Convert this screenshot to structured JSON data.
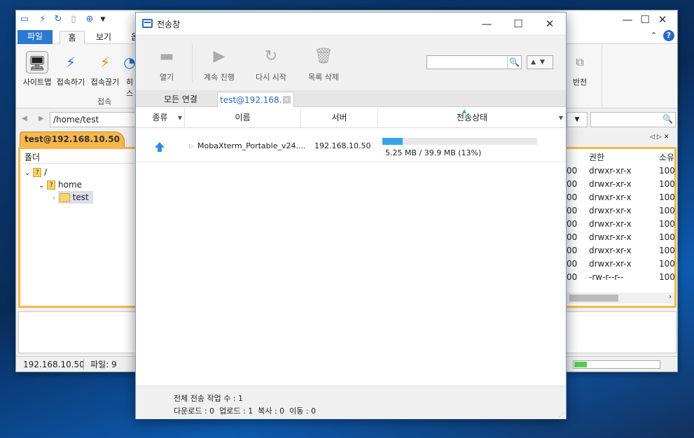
{
  "main_window": {
    "ribbon_tabs": [
      "파일",
      "홈",
      "보기",
      "옵"
    ],
    "ribbon_buttons": [
      "사이트맵",
      "접속하기",
      "접속끊기",
      "히스"
    ],
    "group_label": "접속",
    "right_group_label": "반전",
    "path": "/home/test",
    "pane_tab": "test@192.168.10.50",
    "folder_header": "폴더",
    "tree": [
      {
        "label": "/"
      },
      {
        "label": "home"
      },
      {
        "label": "test"
      }
    ],
    "list_headers": {
      "perm": "권한",
      "owner": "소유"
    },
    "list_rows": [
      {
        "size_tail": "00",
        "perm": "drwxr-xr-x",
        "owner": "100"
      },
      {
        "size_tail": "00",
        "perm": "drwxr-xr-x",
        "owner": "100"
      },
      {
        "size_tail": "00",
        "perm": "drwxr-xr-x",
        "owner": "100"
      },
      {
        "size_tail": "00",
        "perm": "drwxr-xr-x",
        "owner": "100"
      },
      {
        "size_tail": "00",
        "perm": "drwxr-xr-x",
        "owner": "100"
      },
      {
        "size_tail": "00",
        "perm": "drwxr-xr-x",
        "owner": "100"
      },
      {
        "size_tail": "00",
        "perm": "drwxr-xr-x",
        "owner": "100"
      },
      {
        "size_tail": "00",
        "perm": "drwxr-xr-x",
        "owner": "100"
      },
      {
        "size_tail": "00",
        "perm": "-rw-r--r--",
        "owner": "100"
      }
    ],
    "status": {
      "host": "192.168.10.50",
      "files": "파일: 9"
    }
  },
  "transfer_window": {
    "title": "전송창",
    "toolbar": {
      "open": "열기",
      "resume": "계속 진행",
      "restart": "다시 시작",
      "delete_list": "목록 삭제"
    },
    "tabs": {
      "all": "모든 연결",
      "session": "test@192.168...."
    },
    "columns": {
      "kind": "종류",
      "name": "이름",
      "server": "서버",
      "status": "전송상태"
    },
    "rows": [
      {
        "name": "MobaXterm_Portable_v24....",
        "server": "192.168.10.50",
        "progress_text": "5.25 MB / 39.9 MB (13%)",
        "progress": 0.13
      }
    ],
    "footer": {
      "total": "전체 전송 작업 수 : 1",
      "detail": "다운로드 : 0  업로드 : 1  복사 : 0  이동 : 0"
    }
  }
}
